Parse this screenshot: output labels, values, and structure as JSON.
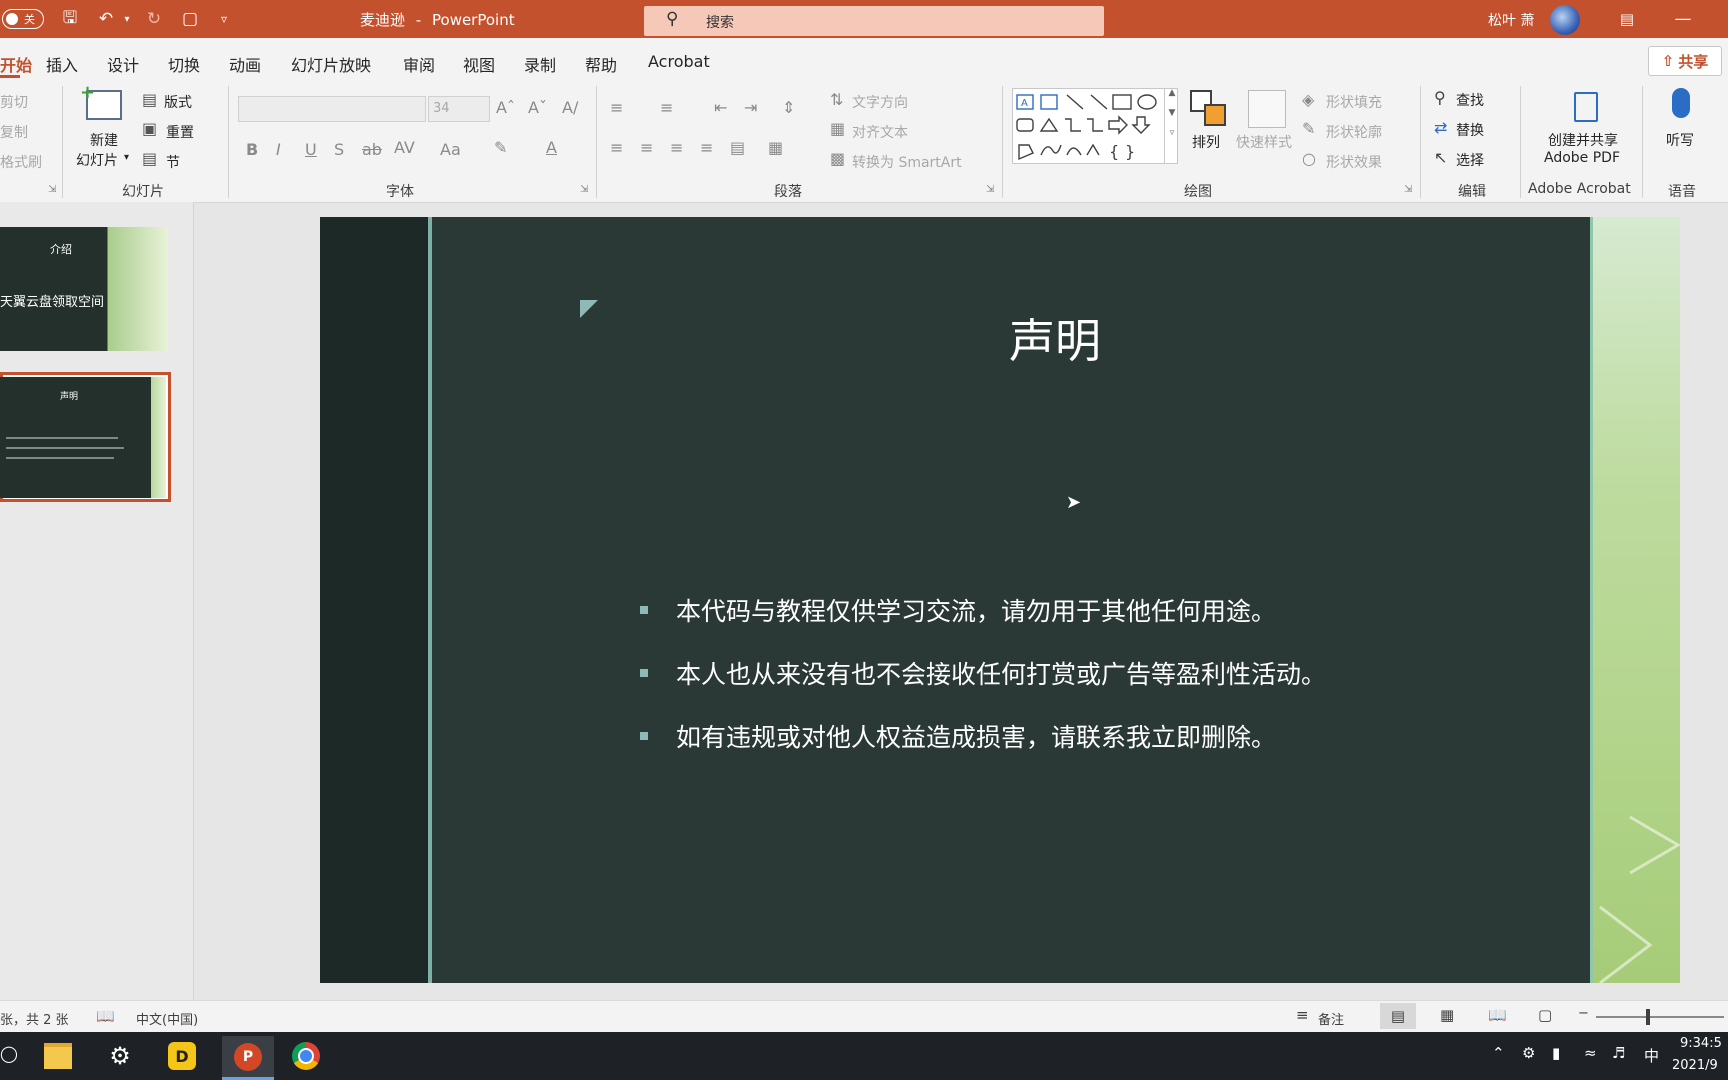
{
  "titlebar": {
    "autosave_label": "关",
    "doc_name": "麦迪逊",
    "separator": "-",
    "app_name": "PowerPoint",
    "search_placeholder": "搜索",
    "user_name": "松叶 萧"
  },
  "tabs": [
    "开始",
    "插入",
    "设计",
    "切换",
    "动画",
    "幻灯片放映",
    "审阅",
    "视图",
    "录制",
    "帮助",
    "Acrobat"
  ],
  "share_label": "共享",
  "ribbon": {
    "clipboard": {
      "cut": "剪切",
      "copy": "复制",
      "format_painter": "格式刷"
    },
    "slides": {
      "new_slide_line1": "新建",
      "new_slide_line2": "幻灯片",
      "layout": "版式",
      "reset": "重置",
      "section": "节",
      "group": "幻灯片"
    },
    "font": {
      "size": "34",
      "group": "字体"
    },
    "paragraph": {
      "text_direction": "文字方向",
      "align_text": "对齐文本",
      "smartart": "转换为 SmartArt",
      "group": "段落"
    },
    "drawing": {
      "arrange": "排列",
      "quick_styles": "快速样式",
      "shape_fill": "形状填充",
      "shape_outline": "形状轮廓",
      "shape_effects": "形状效果",
      "group": "绘图"
    },
    "editing": {
      "find": "查找",
      "replace": "替换",
      "select": "选择",
      "group": "编辑"
    },
    "acrobat": {
      "line1": "创建并共享",
      "line2": "Adobe PDF",
      "group": "Adobe Acrobat"
    },
    "voice": {
      "dictate": "听写",
      "group": "语音"
    }
  },
  "thumbnails": [
    {
      "title": "介绍",
      "subtitle": "天翼云盘领取空间"
    },
    {
      "title": "声明"
    }
  ],
  "slide": {
    "title": "声明",
    "bullets": [
      "本代码与教程仅供学习交流，请勿用于其他任何用途。",
      "本人也从来没有也不会接收任何打赏或广告等盈利性活动。",
      "如有违规或对他人权益造成损害，请联系我立即删除。"
    ]
  },
  "statusbar": {
    "slide_count": "张，共 2 张",
    "language": "中文(中国)",
    "notes": "备注"
  },
  "taskbar": {
    "time": "9:34:5",
    "date": "2021/9",
    "ime": "中"
  },
  "colors": {
    "accent": "#c4512e",
    "slide_bg": "#2a3935",
    "bullet": "#8fb9b6"
  }
}
